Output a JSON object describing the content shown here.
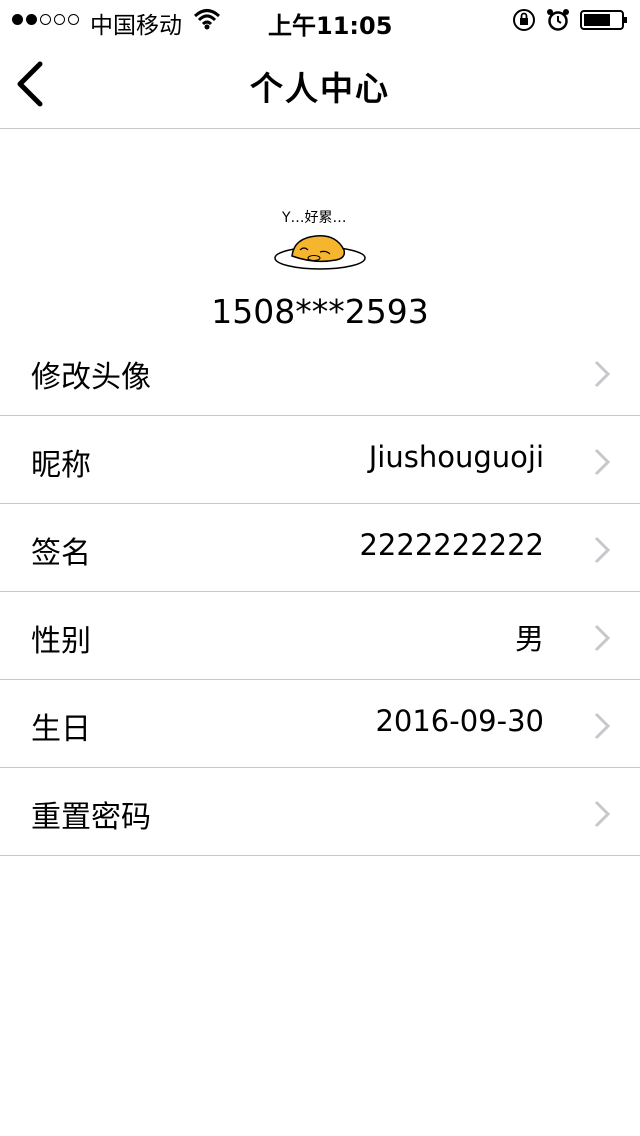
{
  "status_bar": {
    "carrier": "中国移动",
    "time": "上午11:05"
  },
  "nav": {
    "title": "个人中心"
  },
  "profile": {
    "phone": "1508***2593",
    "avatar_text": "Y…好累…"
  },
  "rows": [
    {
      "label": "修改头像",
      "value": ""
    },
    {
      "label": "昵称",
      "value": "Jiushouguoji"
    },
    {
      "label": "签名",
      "value": "2222222222"
    },
    {
      "label": "性别",
      "value": "男"
    },
    {
      "label": "生日",
      "value": "2016-09-30"
    },
    {
      "label": "重置密码",
      "value": ""
    }
  ],
  "icons": {
    "back": "chevron-left-icon",
    "row_arrow": "chevron-right-icon",
    "wifi": "wifi-icon",
    "lock": "rotation-lock-icon",
    "alarm": "alarm-icon",
    "battery": "battery-icon"
  },
  "colors": {
    "divider": "#c8c8c8",
    "chevron": "#c7c7cc",
    "egg_yolk": "#f5b52e"
  }
}
